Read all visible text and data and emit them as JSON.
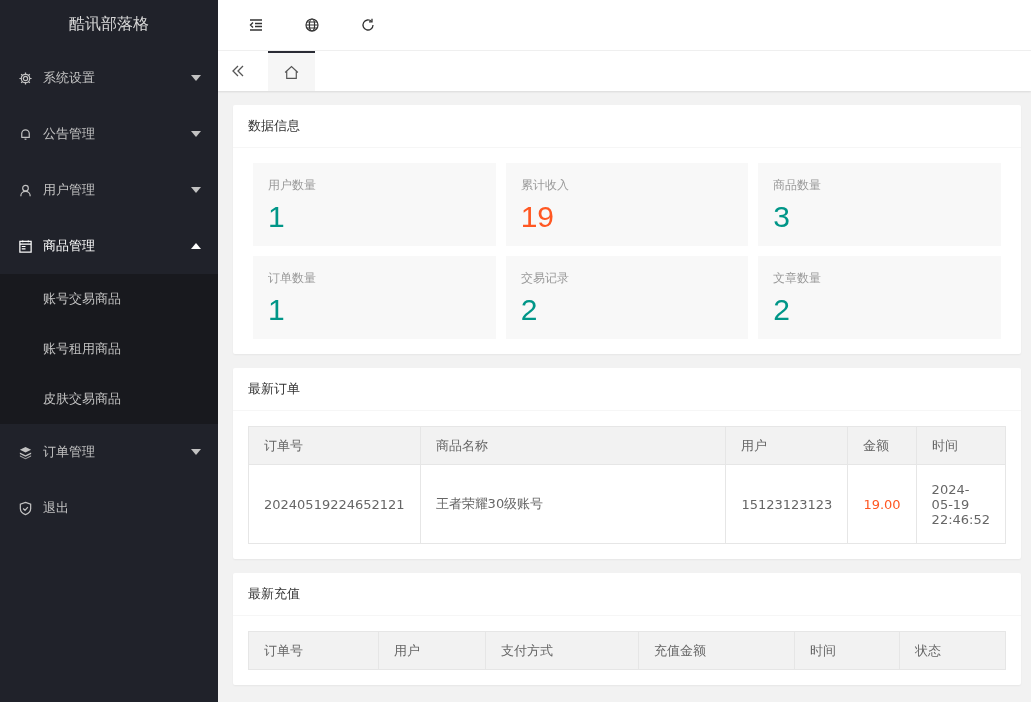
{
  "sidebar": {
    "logo": "酷讯部落格",
    "items": [
      {
        "label": "系统设置",
        "expanded": false
      },
      {
        "label": "公告管理",
        "expanded": false
      },
      {
        "label": "用户管理",
        "expanded": false
      },
      {
        "label": "商品管理",
        "expanded": true,
        "children": [
          {
            "label": "账号交易商品"
          },
          {
            "label": "账号租用商品"
          },
          {
            "label": "皮肤交易商品"
          }
        ]
      },
      {
        "label": "订单管理",
        "expanded": false
      },
      {
        "label": "退出"
      }
    ]
  },
  "tabs": [
    {
      "kind": "home",
      "selected": true
    }
  ],
  "data_info": {
    "title": "数据信息",
    "stats": [
      {
        "label": "用户数量",
        "value": "1",
        "color": "#009688"
      },
      {
        "label": "累计收入",
        "value": "19",
        "color": "#ff5722"
      },
      {
        "label": "商品数量",
        "value": "3",
        "color": "#009688"
      },
      {
        "label": "订单数量",
        "value": "1",
        "color": "#009688"
      },
      {
        "label": "交易记录",
        "value": "2",
        "color": "#009688"
      },
      {
        "label": "文章数量",
        "value": "2",
        "color": "#009688"
      }
    ]
  },
  "latest_orders": {
    "title": "最新订单",
    "columns": [
      {
        "label": "订单号",
        "kind": "plain"
      },
      {
        "label": "商品名称",
        "kind": "plain"
      },
      {
        "label": "用户",
        "kind": "plain"
      },
      {
        "label": "金额",
        "kind": "amount"
      },
      {
        "label": "时间",
        "kind": "plain"
      }
    ],
    "rows": [
      [
        "20240519224652121",
        "王者荣耀30级账号",
        "15123123123",
        "19.00",
        "2024-05-19 22:46:52"
      ]
    ]
  },
  "latest_recharge": {
    "title": "最新充值",
    "columns": [
      {
        "label": "订单号"
      },
      {
        "label": "用户"
      },
      {
        "label": "支付方式"
      },
      {
        "label": "充值金额"
      },
      {
        "label": "时间"
      },
      {
        "label": "状态"
      }
    ]
  }
}
